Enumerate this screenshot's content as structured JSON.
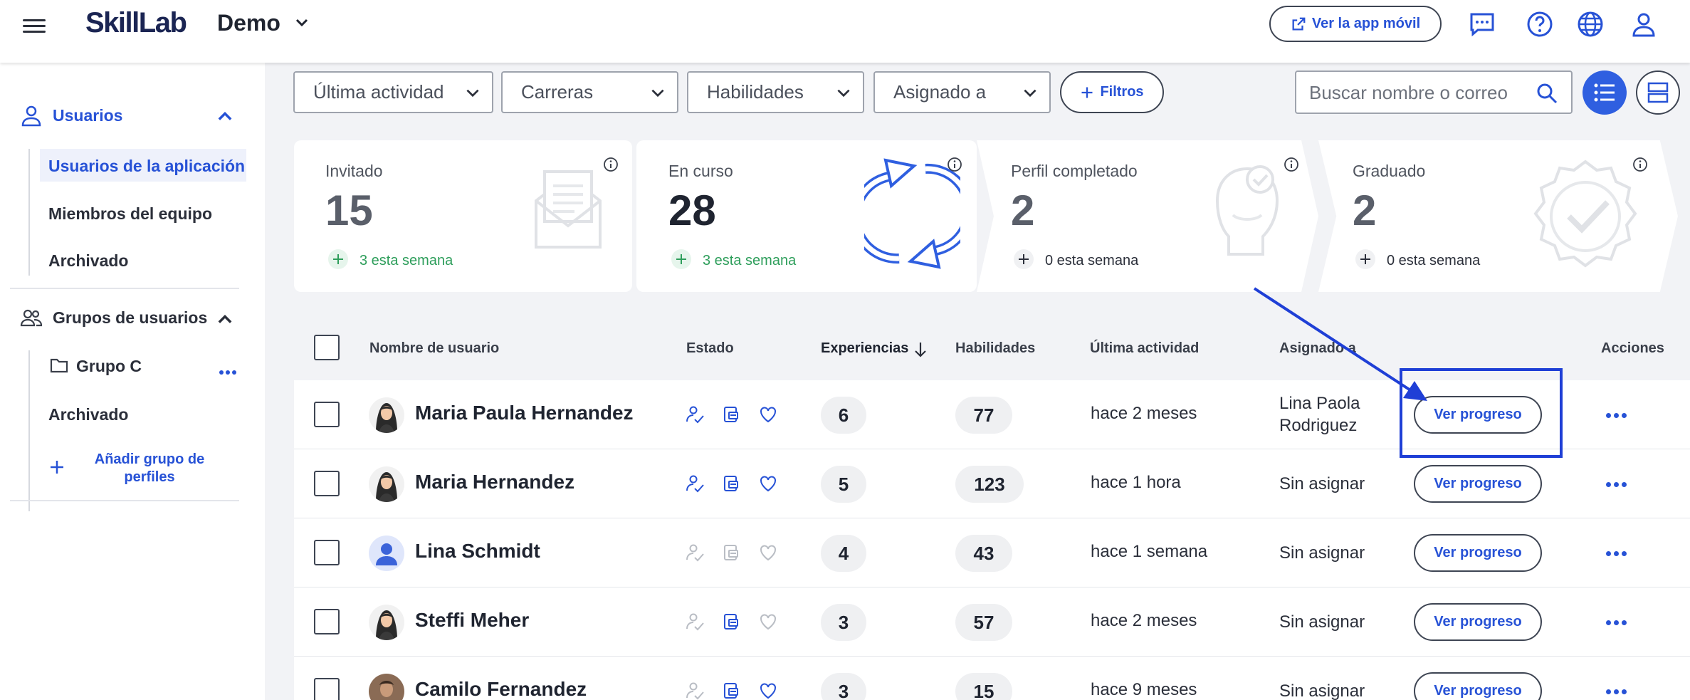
{
  "header": {
    "logo": "SkillLab",
    "organization": "Demo",
    "mobile_app_button": "Ver la app móvil",
    "icons": [
      "hamburger-menu-icon",
      "chat-icon",
      "help-icon",
      "globe-icon",
      "user-icon"
    ]
  },
  "sidebar": {
    "users_section": "Usuarios",
    "users_items": [
      "Usuarios de la aplicación",
      "Miembros del equipo",
      "Archivado"
    ],
    "groups_section": "Grupos de usuarios",
    "group_name": "Grupo C",
    "groups_archived": "Archivado",
    "add_group": "Añadir grupo de perfiles"
  },
  "filters": {
    "last_activity": "Última actividad",
    "careers": "Carreras",
    "skills": "Habilidades",
    "assigned_to": "Asignado a",
    "filters_button": "Filtros",
    "search_placeholder": "Buscar nombre o correo"
  },
  "stats": [
    {
      "title": "Invitado",
      "value": "15",
      "week": "3 esta semana",
      "week_color": "#2e9e5b"
    },
    {
      "title": "En curso",
      "value": "28",
      "week": "3 esta semana",
      "week_color": "#2e9e5b"
    },
    {
      "title": "Perfil completado",
      "value": "2",
      "week": "0 esta semana",
      "week_color": "#2b2f3a"
    },
    {
      "title": "Graduado",
      "value": "2",
      "week": "0 esta semana",
      "week_color": "#2b2f3a"
    }
  ],
  "table": {
    "headers": {
      "name": "Nombre de usuario",
      "status": "Estado",
      "experiences": "Experiencias",
      "skills": "Habilidades",
      "last_activity": "Última actividad",
      "assigned_to": "Asignado a",
      "actions": "Acciones"
    },
    "progress_button": "Ver progreso",
    "rows": [
      {
        "name": "Maria Paula Hernandez",
        "experiences": "6",
        "skills": "77",
        "last_activity": "hace 2 meses",
        "assigned_line1": "Lina Paola",
        "assigned_line2": "Rodriguez"
      },
      {
        "name": "Maria Hernandez",
        "experiences": "5",
        "skills": "123",
        "last_activity": "hace 1 hora",
        "assigned_line1": "Sin asignar",
        "assigned_line2": ""
      },
      {
        "name": "Lina Schmidt",
        "experiences": "4",
        "skills": "43",
        "last_activity": "hace 1 semana",
        "assigned_line1": "Sin asignar",
        "assigned_line2": ""
      },
      {
        "name": "Steffi Meher",
        "experiences": "3",
        "skills": "57",
        "last_activity": "hace 2 meses",
        "assigned_line1": "Sin asignar",
        "assigned_line2": ""
      },
      {
        "name": "Camilo Fernandez",
        "experiences": "3",
        "skills": "15",
        "last_activity": "hace 9 meses",
        "assigned_line1": "Sin asignar",
        "assigned_line2": ""
      }
    ]
  },
  "colors": {
    "accent": "#2752d6",
    "annotation": "#1f3fd6"
  }
}
